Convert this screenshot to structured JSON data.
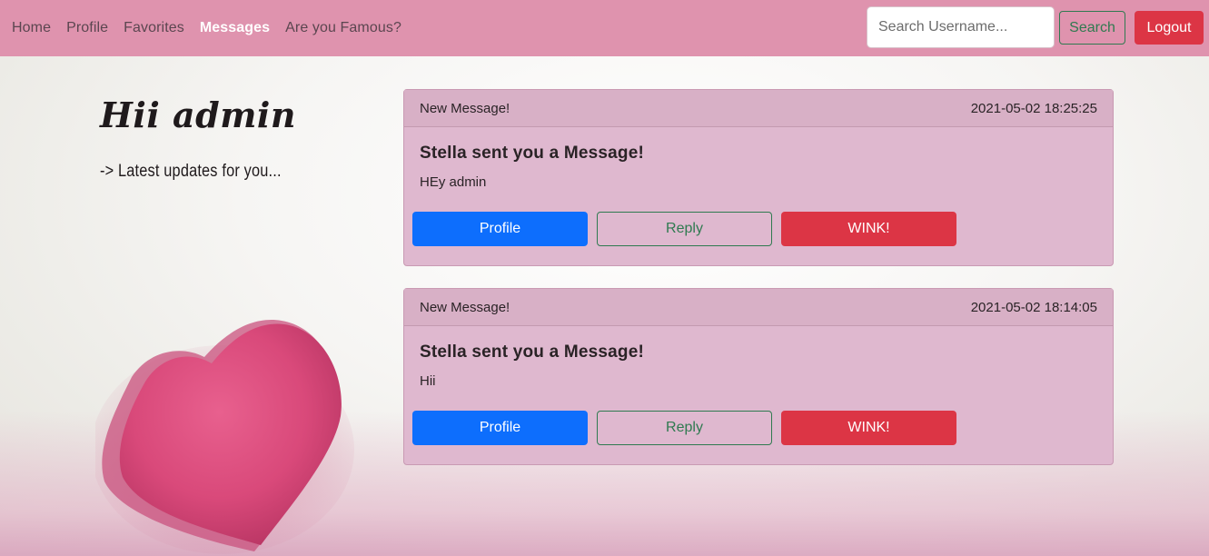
{
  "nav": {
    "links": [
      "Home",
      "Profile",
      "Favorites",
      "Messages",
      "Are you Famous?"
    ],
    "active": "Messages",
    "search_placeholder": "Search Username...",
    "search_label": "Search",
    "logout_label": "Logout"
  },
  "sidebar": {
    "greeting": "Hii admin",
    "subtitle": "-> Latest updates for you..."
  },
  "messages": [
    {
      "header": "New Message!",
      "timestamp": "2021-05-02 18:25:25",
      "title": "Stella sent you a Message!",
      "text": "HEy admin",
      "profile_label": "Profile",
      "reply_label": "Reply",
      "wink_label": "WINK!"
    },
    {
      "header": "New Message!",
      "timestamp": "2021-05-02 18:14:05",
      "title": "Stella sent you a Message!",
      "text": "Hii",
      "profile_label": "Profile",
      "reply_label": "Reply",
      "wink_label": "WINK!"
    }
  ],
  "colors": {
    "navbar": "#df93ae",
    "card": "#dfb8cf",
    "primary": "#0d6efd",
    "danger": "#dc3545",
    "success": "#2f7a50"
  },
  "icons": {
    "decoration": "heart-icon"
  }
}
